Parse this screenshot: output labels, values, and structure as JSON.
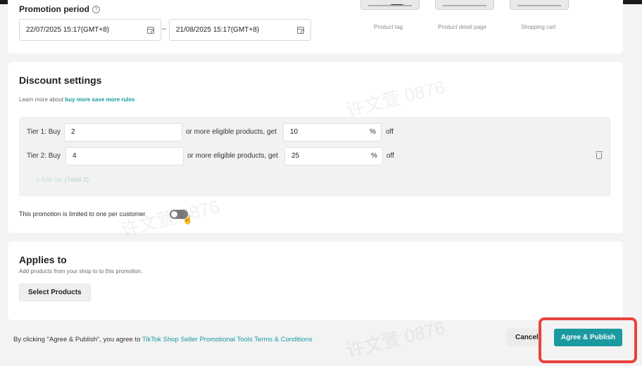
{
  "promotion_period": {
    "title": "Promotion period",
    "start_value": "22/07/2025 15:17(GMT+8)",
    "separator": "–",
    "end_value": "21/08/2025 15:17(GMT+8)"
  },
  "preview": {
    "labels": [
      "Product tag",
      "Product detail page",
      "Shopping cart"
    ]
  },
  "discount_settings": {
    "title": "Discount settings",
    "learn_more_prefix": "Learn more about ",
    "learn_more_link": "buy more save more rules",
    "tiers": [
      {
        "label": "Tier 1: Buy",
        "quantity": "2",
        "middle_text": "or more eligible products, get",
        "discount": "10",
        "unit": "%",
        "suffix": "off"
      },
      {
        "label": "Tier 2: Buy",
        "quantity": "4",
        "middle_text": "or more eligible products, get",
        "discount": "25",
        "unit": "%",
        "suffix": "off"
      }
    ],
    "add_tier_label": "+ Add tier",
    "add_tier_total": "(Total 2)",
    "limit_label": "This promotion is limited to one per customer",
    "limit_enabled": false
  },
  "applies_to": {
    "title": "Applies to",
    "subtitle": "Add products from your shop to to this promotion.",
    "select_button": "Select Products"
  },
  "footer": {
    "agreement_prefix": "By clicking \"Agree & Publish\", you agree to ",
    "terms_link": "TikTok Shop Seller Promotional Tools Terms & Conditions",
    "cancel_label": "Cancel",
    "publish_label": "Agree & Publish"
  },
  "watermark_text": "许文萱 0876",
  "colors": {
    "accent": "#1a9aa0",
    "highlight": "#e8433c"
  }
}
